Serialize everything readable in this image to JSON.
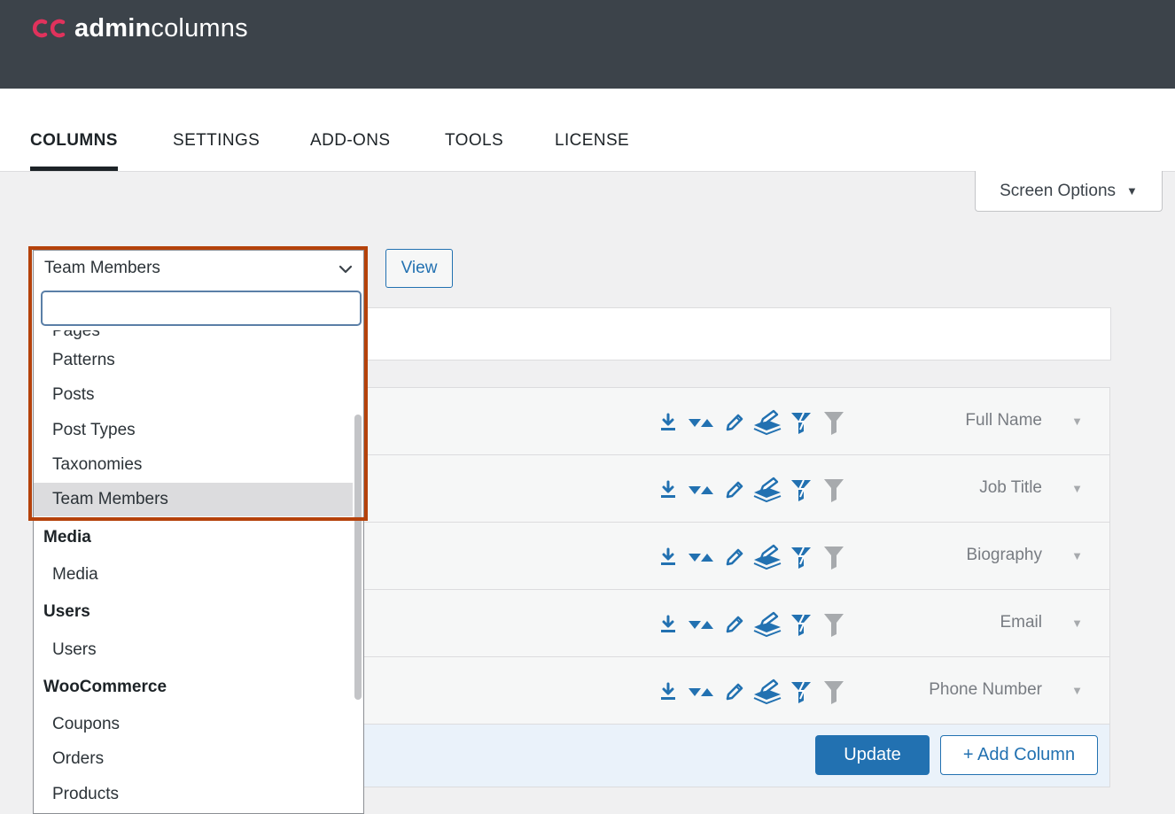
{
  "brand": {
    "name_bold": "admin",
    "name_regular": "columns",
    "accent": "#e0325c"
  },
  "tabs": [
    {
      "label": "COLUMNS",
      "active": true
    },
    {
      "label": "SETTINGS",
      "active": false
    },
    {
      "label": "ADD-ONS",
      "active": false
    },
    {
      "label": "TOOLS",
      "active": false
    },
    {
      "label": "LICENSE",
      "active": false
    }
  ],
  "screen_options": {
    "label": "Screen Options"
  },
  "list_selector": {
    "selected": "Team Members",
    "search_value": "",
    "view_label": "View",
    "items": [
      {
        "kind": "item",
        "label": "Pages"
      },
      {
        "kind": "item",
        "label": "Patterns"
      },
      {
        "kind": "item",
        "label": "Posts"
      },
      {
        "kind": "item",
        "label": "Post Types"
      },
      {
        "kind": "item",
        "label": "Taxonomies"
      },
      {
        "kind": "item",
        "label": "Team Members",
        "selected": true
      },
      {
        "kind": "group",
        "label": "Media"
      },
      {
        "kind": "item",
        "label": "Media"
      },
      {
        "kind": "group",
        "label": "Users"
      },
      {
        "kind": "item",
        "label": "Users"
      },
      {
        "kind": "group",
        "label": "WooCommerce"
      },
      {
        "kind": "item",
        "label": "Coupons"
      },
      {
        "kind": "item",
        "label": "Orders"
      },
      {
        "kind": "item",
        "label": "Products"
      }
    ]
  },
  "columns": [
    {
      "label": "Full Name"
    },
    {
      "label": "Job Title"
    },
    {
      "label": "Biography"
    },
    {
      "label": "Email"
    },
    {
      "label": "Phone Number"
    }
  ],
  "column_feature_icons": [
    "export-icon",
    "sort-icon",
    "edit-icon",
    "bulk-edit-icon",
    "smart-filter-icon",
    "filter-icon"
  ],
  "footer": {
    "update_label": "Update",
    "add_column_label": "+ Add Column"
  },
  "colors": {
    "primary": "#2271b1",
    "topbar": "#3c434a",
    "highlight": "#b5420b"
  }
}
